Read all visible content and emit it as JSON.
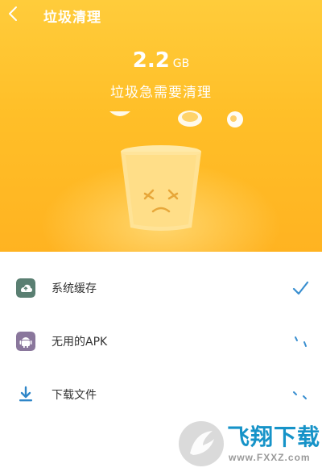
{
  "header": {
    "title": "垃圾清理"
  },
  "summary": {
    "size_value": "2.2",
    "size_unit": "GB",
    "subtitle": "垃圾急需要清理"
  },
  "items": [
    {
      "label": "系统缓存",
      "icon": "cloud-icon",
      "icon_color": "#5a7f72",
      "status": "done"
    },
    {
      "label": "无用的APK",
      "icon": "android-icon",
      "icon_color": "#8a779c",
      "status": "scanning"
    },
    {
      "label": "下载文件",
      "icon": "download-icon",
      "icon_color": "#2f86c8",
      "status": "scanning"
    }
  ],
  "watermark": {
    "title": "飞翔下载",
    "url": "www.FXXZ.com"
  },
  "colors": {
    "accent": "#ffbf28",
    "check": "#3a8fd0",
    "spinner": "#3a8fd0"
  }
}
